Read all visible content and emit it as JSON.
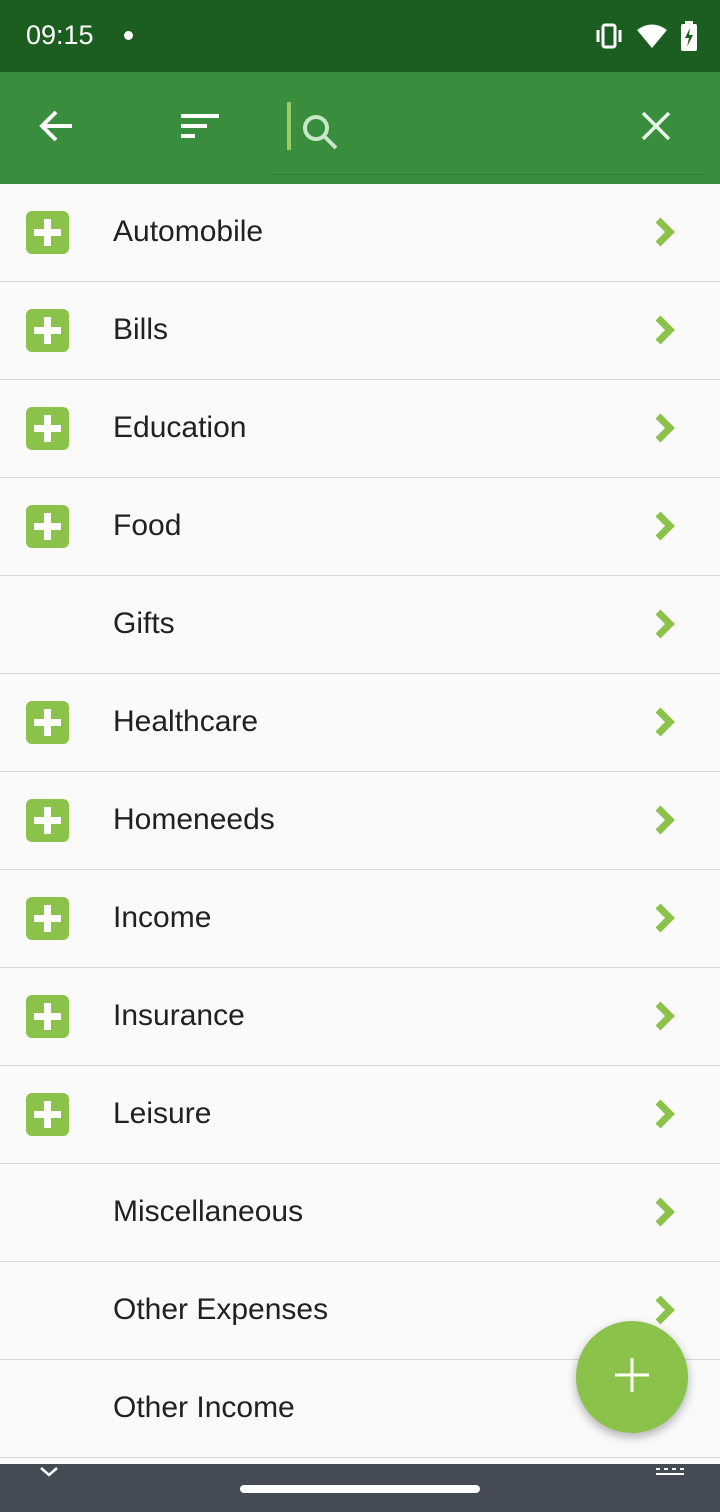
{
  "status_bar": {
    "time": "09:15",
    "icons": [
      "notification-dot",
      "vibrate-icon",
      "wifi-icon",
      "battery-charging-icon"
    ]
  },
  "toolbar": {
    "back_icon": "arrow-left",
    "sort_icon": "sort",
    "search_icon": "search",
    "close_icon": "close",
    "search_value": "",
    "search_placeholder": ""
  },
  "categories": [
    {
      "label": "Automobile",
      "has_children": true
    },
    {
      "label": "Bills",
      "has_children": true
    },
    {
      "label": "Education",
      "has_children": true
    },
    {
      "label": "Food",
      "has_children": true
    },
    {
      "label": "Gifts",
      "has_children": false
    },
    {
      "label": "Healthcare",
      "has_children": true
    },
    {
      "label": "Homeneeds",
      "has_children": true
    },
    {
      "label": "Income",
      "has_children": true
    },
    {
      "label": "Insurance",
      "has_children": true
    },
    {
      "label": "Leisure",
      "has_children": true
    },
    {
      "label": "Miscellaneous",
      "has_children": false
    },
    {
      "label": "Other Expenses",
      "has_children": false
    },
    {
      "label": "Other Income",
      "has_children": false
    }
  ],
  "fab": {
    "icon": "plus"
  },
  "colors": {
    "status_bar": "#1b5e20",
    "toolbar": "#388e3c",
    "accent": "#8bc34a",
    "nav_bar": "#444b54"
  }
}
